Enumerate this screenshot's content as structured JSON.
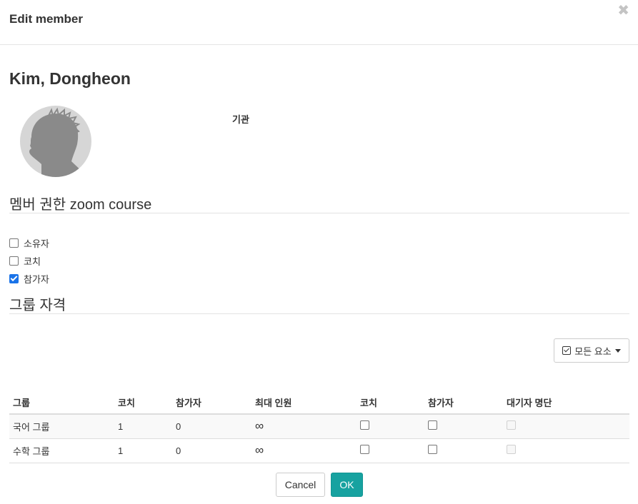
{
  "dialog": {
    "title": "Edit member",
    "close_icon": "close-icon",
    "close_symbol": "✖"
  },
  "member": {
    "name": "Kim, Dongheon",
    "org_label": "기관"
  },
  "roles": {
    "title": "멤버 권한 zoom course",
    "options": [
      {
        "label": "소유자",
        "checked": false
      },
      {
        "label": "코치",
        "checked": false
      },
      {
        "label": "참가자",
        "checked": true
      }
    ]
  },
  "groups": {
    "title": "그룹 자격",
    "select_all_label": "모든 요소",
    "columns": [
      "그룹",
      "코치",
      "참가자",
      "최대 인원",
      "코치",
      "참가자",
      "대기자 명단"
    ],
    "rows": [
      {
        "name": "국어 그룹",
        "coaches": "1",
        "participants": "0",
        "max": "∞",
        "coach_checked": false,
        "participant_checked": false,
        "waitlist_disabled": true
      },
      {
        "name": "수학 그룹",
        "coaches": "1",
        "participants": "0",
        "max": "∞",
        "coach_checked": false,
        "participant_checked": false,
        "waitlist_disabled": true
      }
    ]
  },
  "footer": {
    "cancel_label": "Cancel",
    "ok_label": "OK"
  },
  "colors": {
    "ok_button": "#17a2a0",
    "checkbox_checked": "#1a73e8"
  }
}
